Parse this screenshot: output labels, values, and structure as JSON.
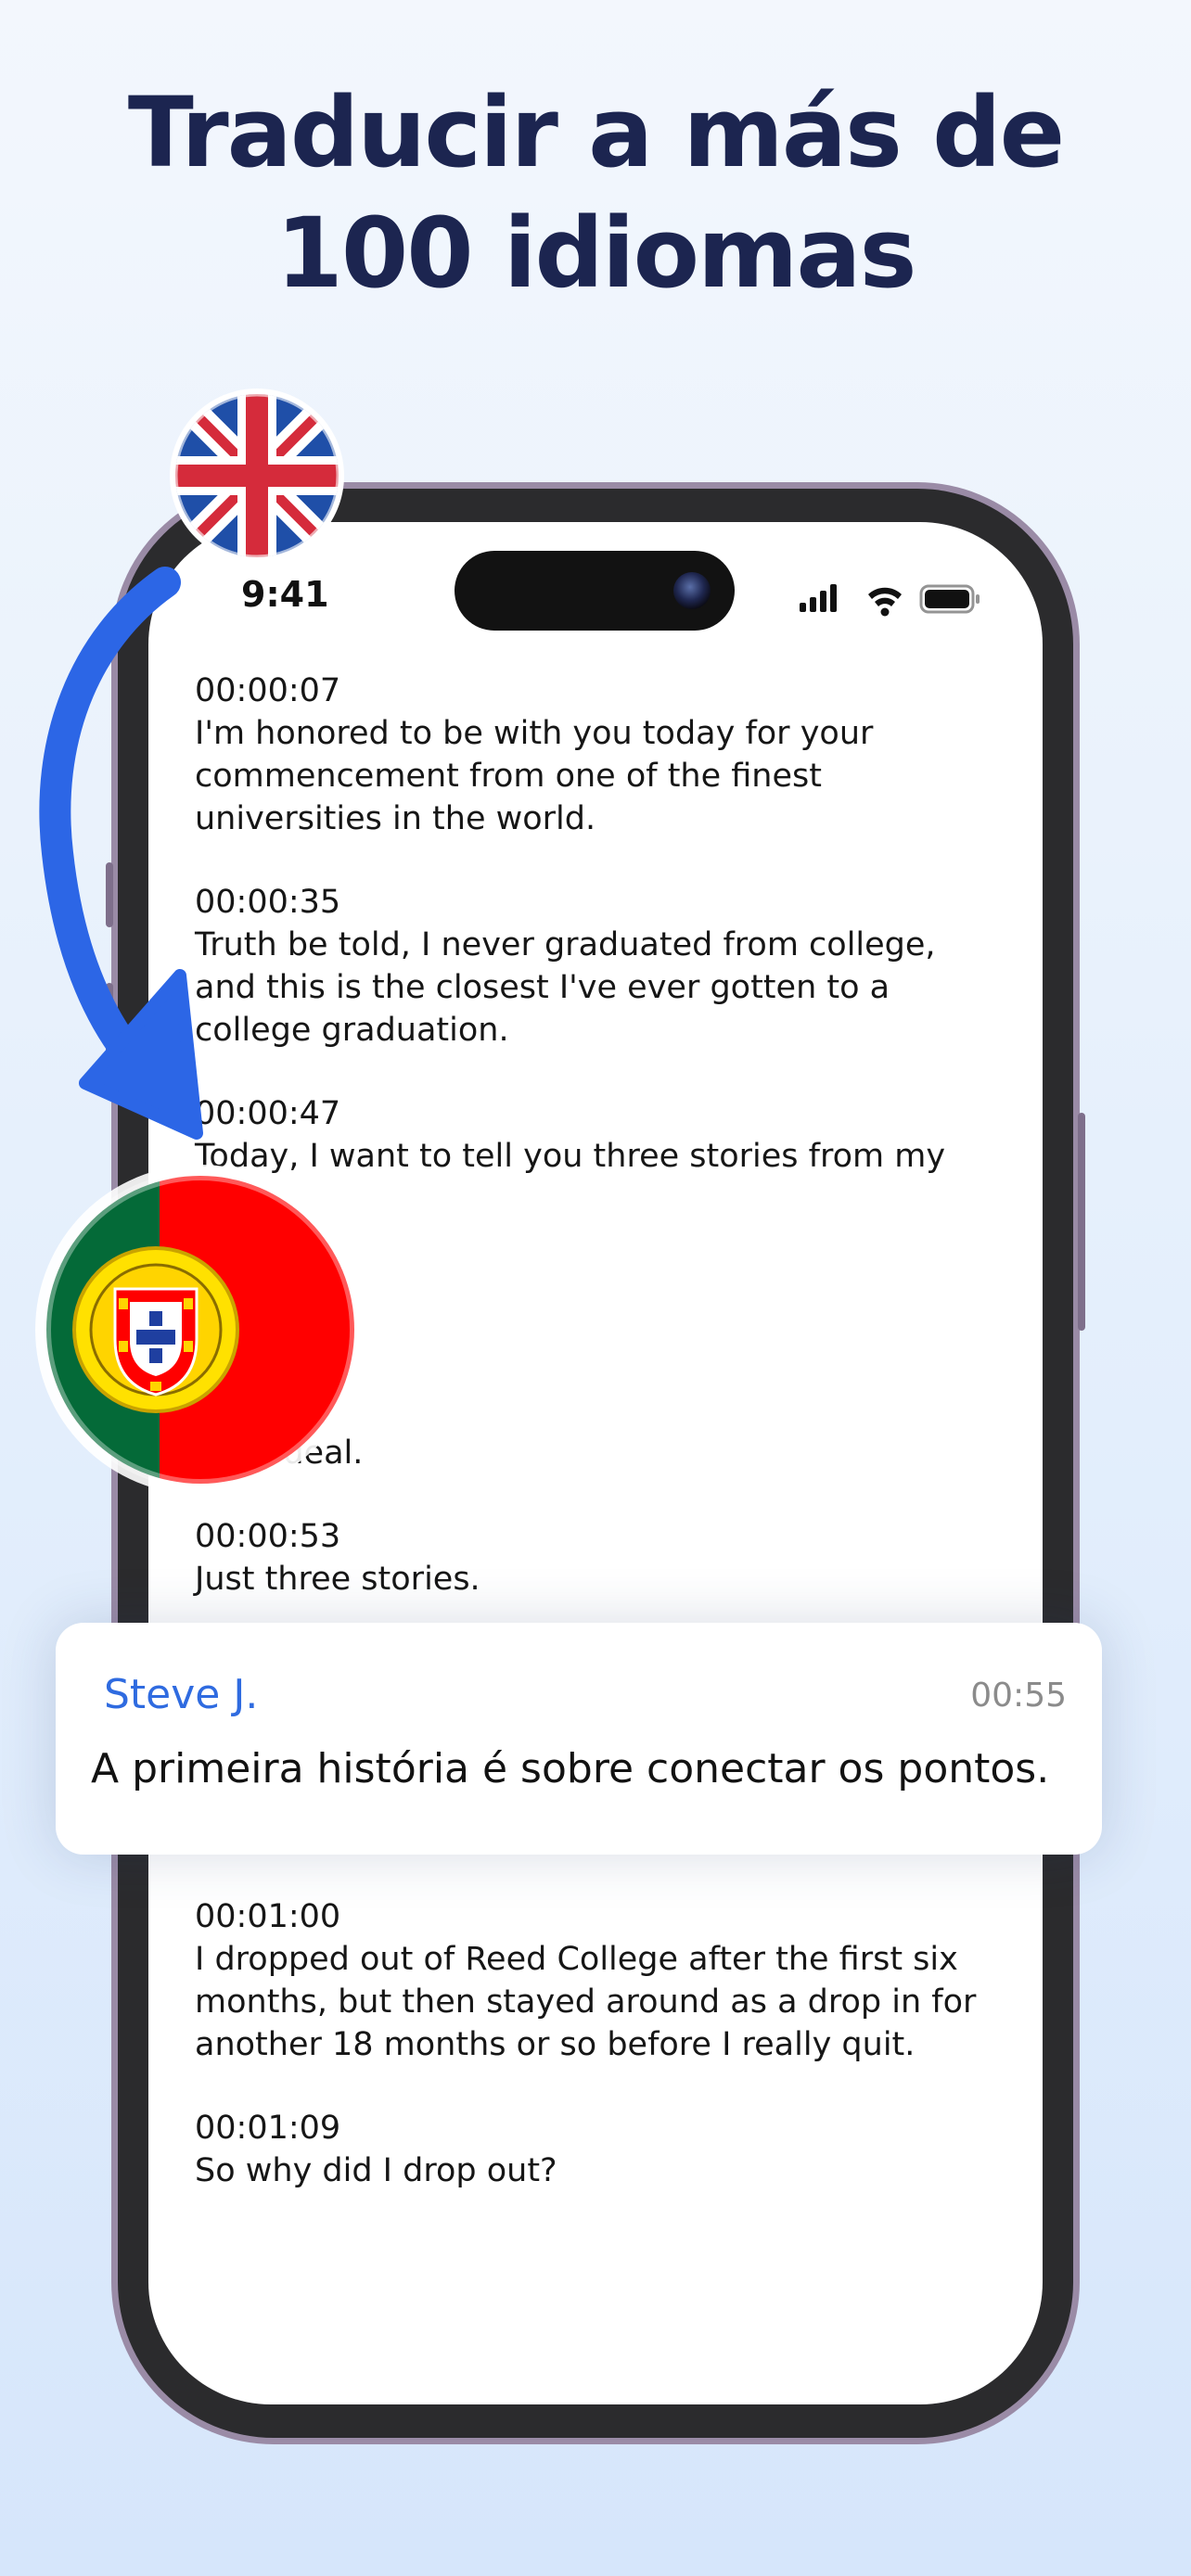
{
  "headline": {
    "line1": "Traducir a más de",
    "line2": "100 idiomas"
  },
  "status_bar": {
    "time": "9:41"
  },
  "transcript": [
    {
      "timestamp": "00:00:07",
      "text": "I'm honored to be with you today for your commencement from one of the finest universities in the world."
    },
    {
      "timestamp": "00:00:35",
      "text": "Truth be told, I never graduated from college, and this is the closest I've ever gotten to a college graduation."
    },
    {
      "timestamp": "00:00:47",
      "text": "Today, I want to tell you three stories from my"
    },
    {
      "timestamp": "",
      "text": "g deal."
    },
    {
      "timestamp": "00:00:53",
      "text": "Just three stories."
    },
    {
      "timestamp": "00:01:00",
      "text": "I dropped out of Reed College after the first six months, but then stayed around as a drop in for another 18 months or so before I really quit."
    },
    {
      "timestamp": "00:01:09",
      "text": "So why did I drop out?"
    }
  ],
  "translation_card": {
    "speaker": "Steve J.",
    "time": "00:55",
    "text": "A primeira história é sobre conectar os pontos."
  },
  "colors": {
    "headline": "#1c2550",
    "speaker": "#2f6be0",
    "arrow": "#2c66e6"
  },
  "icons": [
    "uk-flag-icon",
    "portugal-flag-icon",
    "arrow-icon",
    "signal-icon",
    "wifi-icon",
    "battery-icon"
  ]
}
